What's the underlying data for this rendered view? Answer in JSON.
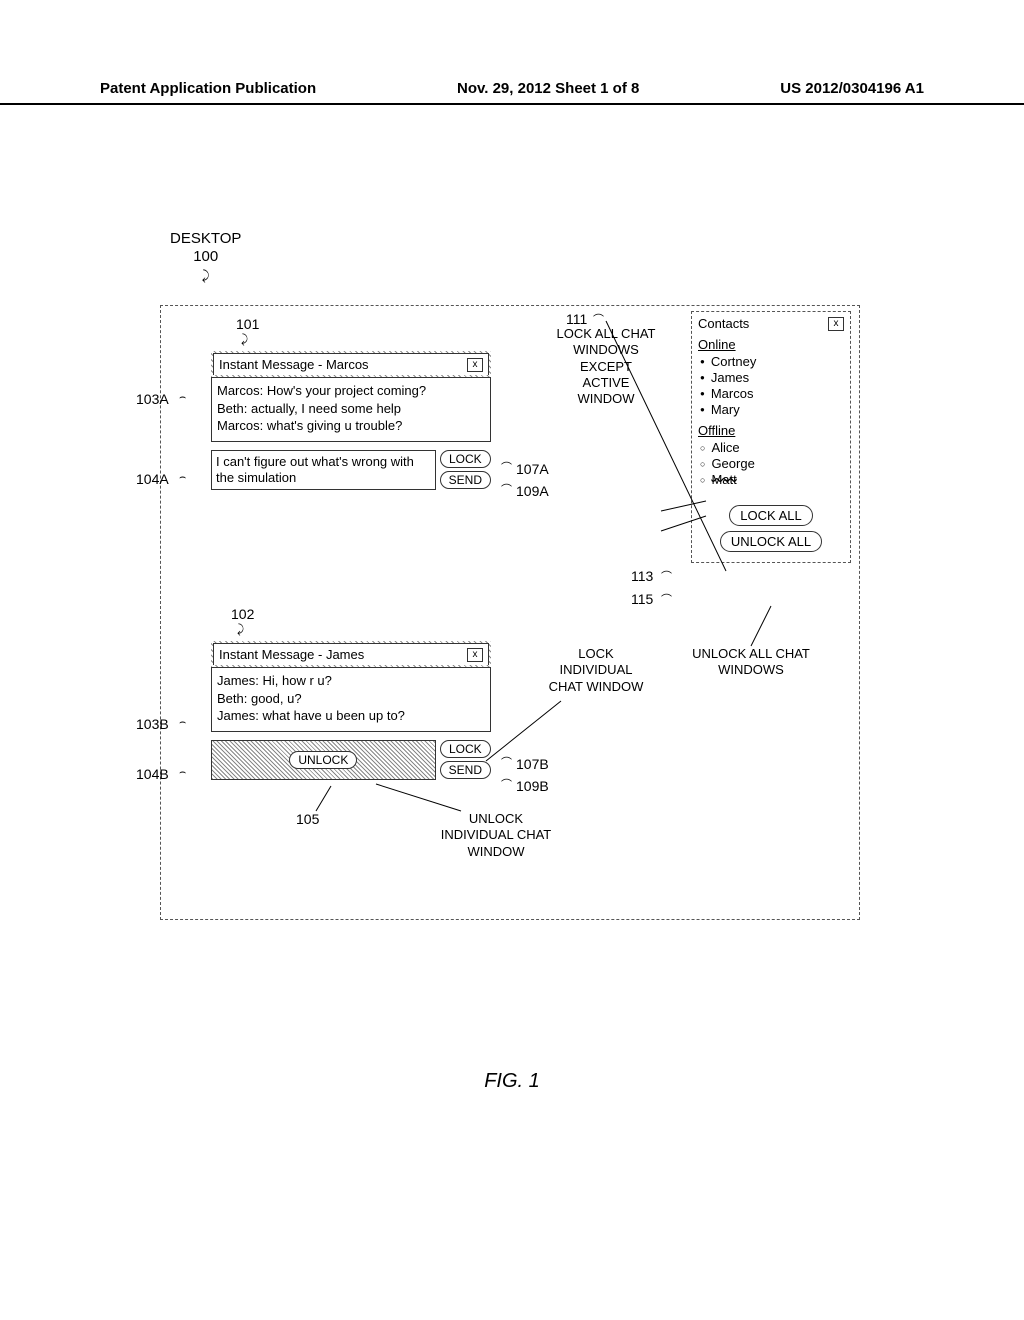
{
  "header": {
    "left": "Patent Application Publication",
    "center": "Nov. 29, 2012  Sheet 1 of 8",
    "right": "US 2012/0304196 A1"
  },
  "desktop_label": {
    "title": "DESKTOP",
    "ref": "100"
  },
  "refs": {
    "r101": "101",
    "r102": "102",
    "r103A": "103A",
    "r104A": "104A",
    "r103B": "103B",
    "r104B": "104B",
    "r105": "105",
    "r107A": "107A",
    "r109A": "109A",
    "r107B": "107B",
    "r109B": "109B",
    "r111": "111",
    "r113": "113",
    "r115": "115"
  },
  "chat101": {
    "title": "Instant Message - Marcos",
    "line1": "Marcos:  How's your project coming?",
    "line2": "Beth: actually, I need some help",
    "line3": "Marcos:  what's giving u trouble?",
    "input": "I can't figure out what's wrong with the simulation",
    "lock": "LOCK",
    "send": "SEND"
  },
  "chat102": {
    "title": "Instant Message - James",
    "line1": "James:  Hi, how r u?",
    "line2": "Beth: good, u?",
    "line3": "James: what have u been up to?",
    "unlock_btn": "UNLOCK",
    "lock": "LOCK",
    "send": "SEND"
  },
  "contacts": {
    "title": "Contacts",
    "online_hdr": "Online",
    "online": [
      "Cortney",
      "James",
      "Marcos",
      "Mary"
    ],
    "offline_hdr": "Offline",
    "offline": [
      "Alice",
      "George",
      "Matt"
    ],
    "lock_all": "LOCK ALL",
    "unlock_all": "UNLOCK ALL"
  },
  "callouts": {
    "lock_all_except": "LOCK ALL CHAT WINDOWS EXCEPT ACTIVE WINDOW",
    "lock_individual": "LOCK INDIVIDUAL CHAT WINDOW",
    "unlock_individual": "UNLOCK INDIVIDUAL CHAT WINDOW",
    "unlock_all_chat": "UNLOCK ALL CHAT WINDOWS"
  },
  "figure_caption": "FIG. 1"
}
